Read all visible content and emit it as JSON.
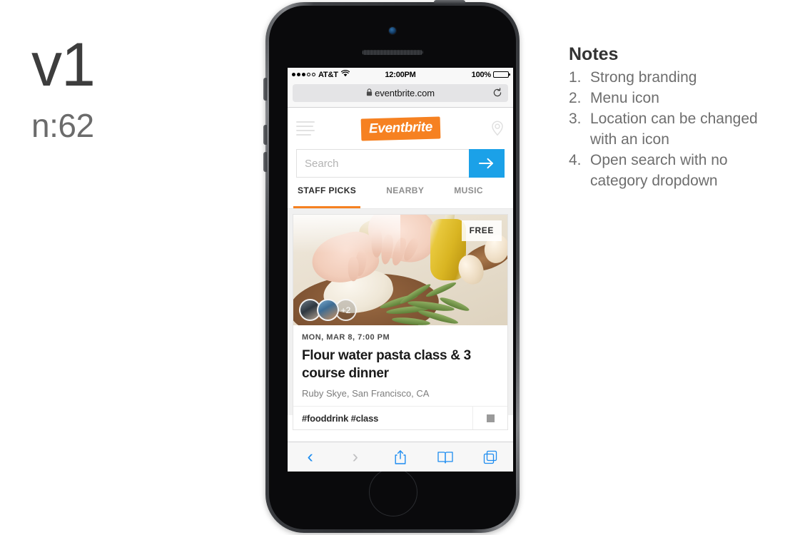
{
  "version": {
    "label": "v1",
    "count": "n:62"
  },
  "notes": {
    "title": "Notes",
    "items": [
      {
        "num": "1.",
        "text": "Strong branding"
      },
      {
        "num": "2.",
        "text": "Menu icon"
      },
      {
        "num": "3.",
        "text": "Location can be changed with an icon"
      },
      {
        "num": "4.",
        "text": "Open search with no category dropdown"
      }
    ]
  },
  "phone": {
    "status_bar": {
      "carrier": "AT&T",
      "wifi_icon": "wifi-icon",
      "time": "12:00PM",
      "battery_percent": "100%",
      "battery_icon": "battery-full-icon"
    },
    "browser": {
      "lock_icon": "lock-icon",
      "url": "eventbrite.com",
      "reload_icon": "reload-icon",
      "toolbar": {
        "back_icon": "chevron-left-icon",
        "forward_icon": "chevron-right-icon",
        "share_icon": "share-icon",
        "bookmarks_icon": "book-icon",
        "tabs_icon": "tabs-icon"
      }
    },
    "site": {
      "menu_icon": "hamburger-menu-icon",
      "logo_text": "Eventbrite",
      "logo_color": "#f68121",
      "location_icon": "location-pin-icon",
      "search": {
        "placeholder": "Search",
        "value": "",
        "submit_icon": "arrow-right-icon",
        "submit_color": "#1ba1e8"
      },
      "tabs": [
        {
          "label": "STAFF PICKS",
          "active": true
        },
        {
          "label": "NEARBY",
          "active": false
        },
        {
          "label": "MUSIC",
          "active": false
        }
      ],
      "event_card": {
        "badge": "FREE",
        "attendees_more": "+2",
        "date": "MON, MAR 8, 7:00 PM",
        "title": "Flour water pasta class & 3 course dinner",
        "venue": "Ruby Skye, San Francisco, CA",
        "tags": "#fooddrink  #class",
        "save_icon": "save-icon"
      }
    }
  }
}
